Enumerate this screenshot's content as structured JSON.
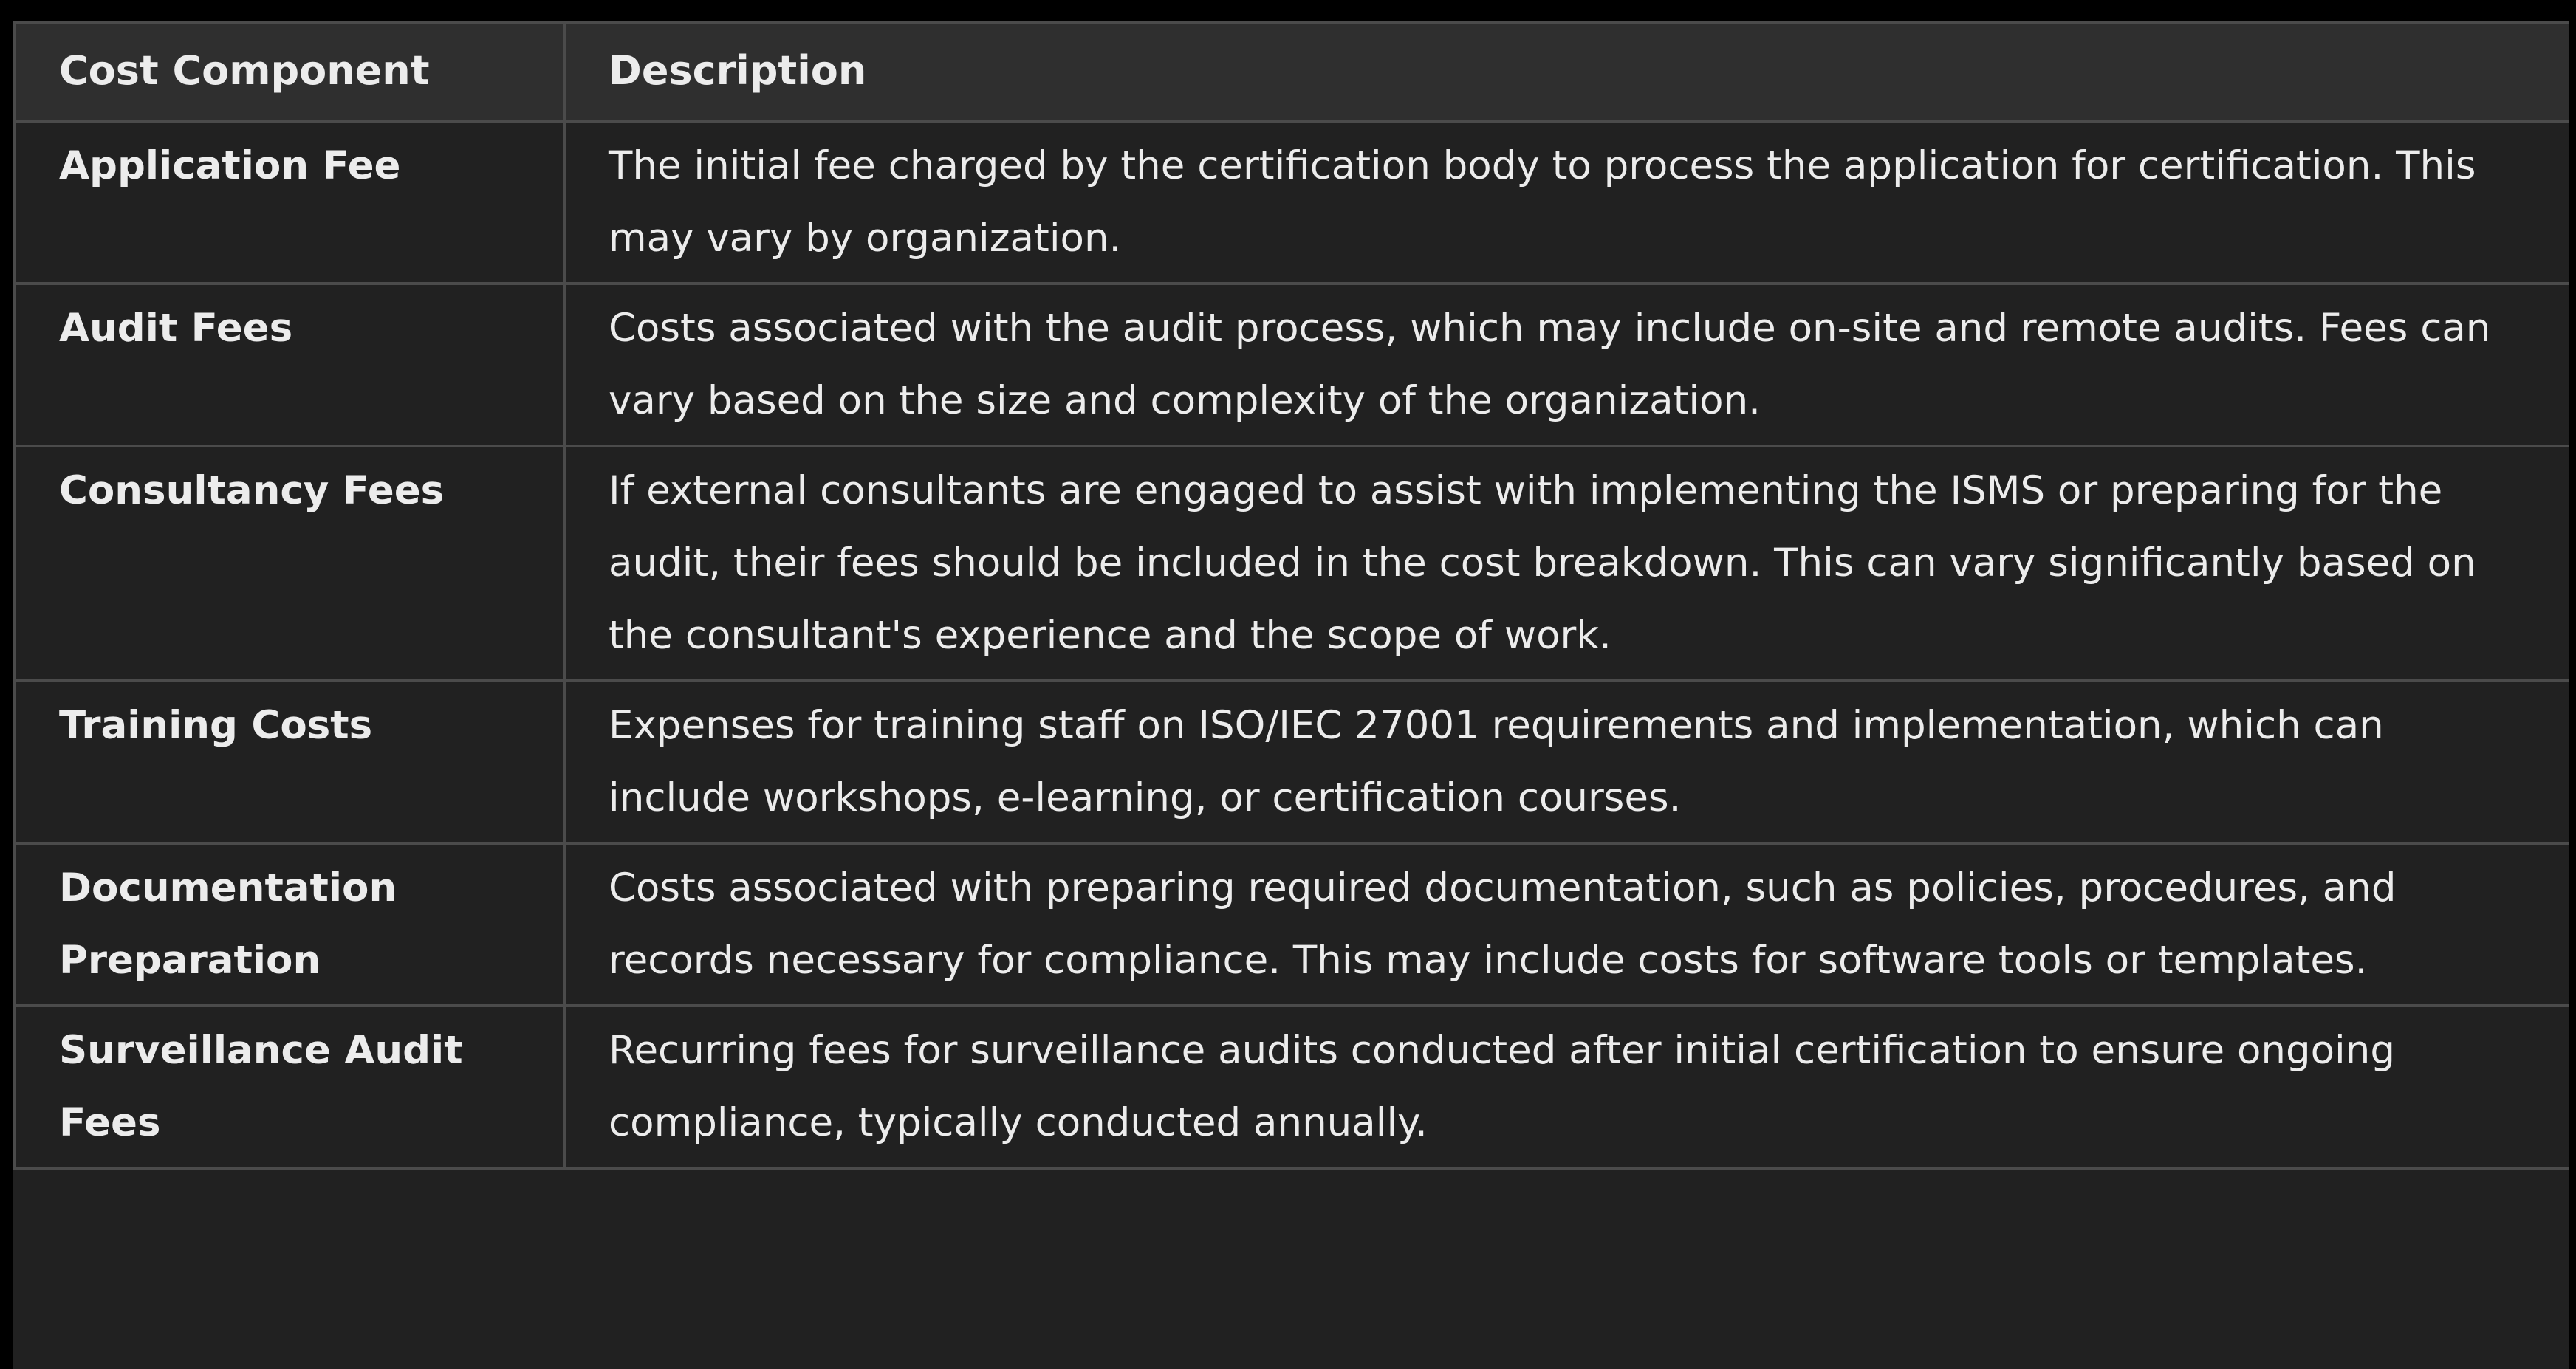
{
  "table": {
    "headers": {
      "component": "Cost Component",
      "description": "Description"
    },
    "rows": [
      {
        "component": "Application Fee",
        "description": "The initial fee charged by the certification body to process the application for certification. This may vary by organization."
      },
      {
        "component": "Audit Fees",
        "description": "Costs associated with the audit process, which may include on-site and remote audits. Fees can vary based on the size and complexity of the organization."
      },
      {
        "component": "Consultancy Fees",
        "description": "If external consultants are engaged to assist with implementing the ISMS or preparing for the audit, their fees should be included in the cost breakdown. This can vary significantly based on the consultant's experience and the scope of work."
      },
      {
        "component": "Training Costs",
        "description": "Expenses for training staff on ISO/IEC 27001 requirements and implementation, which can include workshops, e-learning, or certification courses."
      },
      {
        "component": "Documentation Preparation",
        "description": "Costs associated with preparing required documentation, such as policies, procedures, and records necessary for compliance. This may include costs for software tools or templates."
      },
      {
        "component": "Surveillance Audit Fees",
        "description": "Recurring fees for surveillance audits conducted after initial certification to ensure ongoing compliance, typically conducted annually."
      }
    ]
  },
  "colors": {
    "background": "#212121",
    "header_background": "#2f2f2f",
    "border": "#4b4b4b",
    "text": "#ececec"
  }
}
